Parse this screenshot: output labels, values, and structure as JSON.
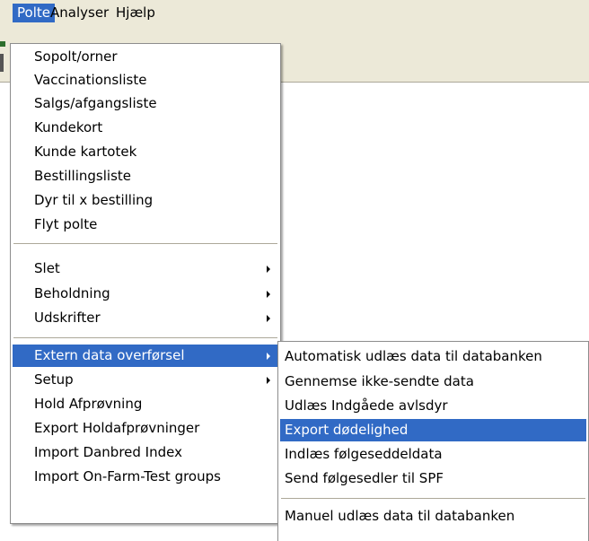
{
  "menubar": {
    "items": [
      {
        "label": "Polte"
      },
      {
        "label": "Analyser"
      },
      {
        "label": "Hjælp"
      }
    ]
  },
  "polte_menu": {
    "items": [
      {
        "label": "Sopolt/orner"
      },
      {
        "label": "Vaccinationsliste"
      },
      {
        "label": "Salgs/afgangsliste"
      },
      {
        "label": "Kundekort"
      },
      {
        "label": "Kunde kartotek"
      },
      {
        "label": "Bestillingsliste"
      },
      {
        "label": "Dyr til x bestilling"
      },
      {
        "label": "Flyt polte"
      },
      {
        "label": "Slet",
        "submenu": true
      },
      {
        "label": "Beholdning",
        "submenu": true
      },
      {
        "label": "Udskrifter",
        "submenu": true
      },
      {
        "label": "Extern data overførsel",
        "submenu": true,
        "highlighted": true
      },
      {
        "label": "Setup",
        "submenu": true
      },
      {
        "label": "Hold Afprøvning"
      },
      {
        "label": "Export Holdafprøvninger"
      },
      {
        "label": "Import Danbred Index"
      },
      {
        "label": "Import On-Farm-Test groups"
      }
    ]
  },
  "extern_submenu": {
    "items": [
      {
        "label": "Automatisk udlæs data til databanken"
      },
      {
        "label": "Gennemse ikke-sendte data"
      },
      {
        "label": "Udlæs Indgåede avlsdyr"
      },
      {
        "label": "Export dødelighed",
        "highlighted": true
      },
      {
        "label": "Indlæs følgeseddeldata"
      },
      {
        "label": "Send følgesedler til SPF"
      },
      {
        "label": "Manuel udlæs data til databanken"
      }
    ]
  },
  "colors": {
    "highlight": "#316ac5",
    "menubar_bg": "#ece9d8"
  }
}
